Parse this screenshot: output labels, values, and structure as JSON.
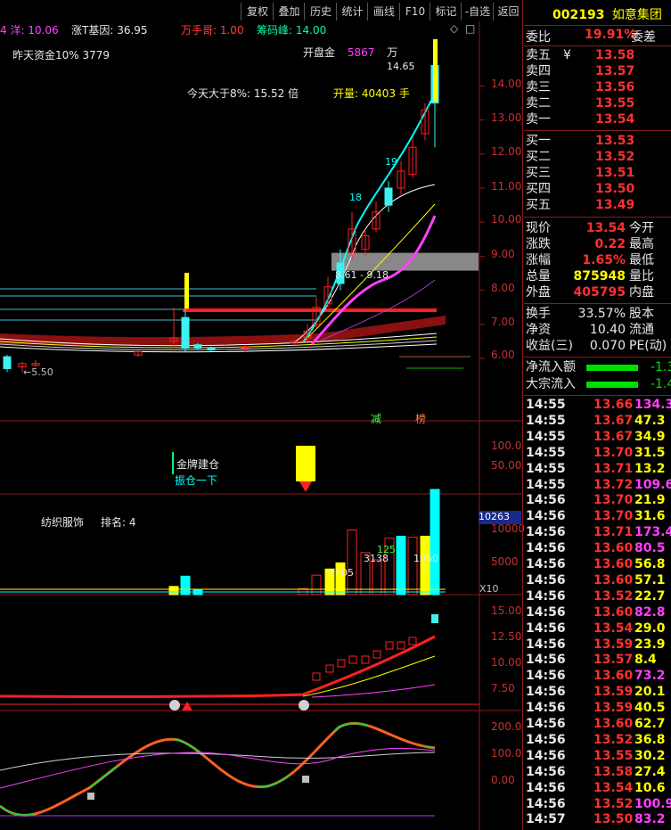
{
  "toolbar": {
    "buttons": [
      "复权",
      "叠加",
      "历史",
      "统计",
      "画线",
      "F10",
      "标记",
      "-自选",
      "返回"
    ]
  },
  "chart_header": {
    "ma_label": "4 洋: 10.06",
    "gene_label": "涨T基因: 36.95",
    "wanshouge": "万手哥: 1.00",
    "chouma": "筹码峰: 14.00"
  },
  "annotations": {
    "yesterday_fund": "昨天资金10%   3779",
    "open_amount_label": "开盘金",
    "open_amount_value": "5867",
    "open_amount_unit": "万",
    "today_ratio": "今天大于8%: 15.52 倍",
    "open_volume": "开量: 40403 手",
    "price_range": "8.61 - 9.18",
    "high_label": "14.65",
    "low_label": "5.50",
    "tag_jian": "减",
    "tag_bang": "榜",
    "jinpai": "金牌建仓",
    "zhencang": "振仓一下",
    "sector": "纺织服饰",
    "rank": "排名: 4",
    "vol_current": "10263",
    "vol_x10": "X10",
    "num_2505": "2505",
    "num_3138": "3138",
    "num_1050": "1050",
    "num_125": "125",
    "num_18": "18",
    "num_19": "19"
  },
  "price_axis": [
    "14.00",
    "13.00",
    "12.00",
    "11.00",
    "10.00",
    "9.00",
    "8.00",
    "7.00",
    "6.00"
  ],
  "sub1_axis": [
    "100.0",
    "50.00"
  ],
  "sub2_axis": [
    "10000",
    "5000"
  ],
  "sub3_axis": [
    "15.00",
    "12.50",
    "10.00",
    "7.50"
  ],
  "sub4_axis": [
    "200.0",
    "100.0",
    "0.00"
  ],
  "stock": {
    "code": "002193",
    "name": "如意集团"
  },
  "summary": {
    "weibi_label": "委比",
    "weibi_value": "19.91%",
    "weicha_label": "委差"
  },
  "asks": [
    {
      "label": "卖五",
      "flag": "¥",
      "price": "13.58"
    },
    {
      "label": "卖四",
      "flag": "",
      "price": "13.57"
    },
    {
      "label": "卖三",
      "flag": "",
      "price": "13.56"
    },
    {
      "label": "卖二",
      "flag": "",
      "price": "13.55"
    },
    {
      "label": "卖一",
      "flag": "",
      "price": "13.54"
    }
  ],
  "bids": [
    {
      "label": "买一",
      "price": "13.53"
    },
    {
      "label": "买二",
      "price": "13.52"
    },
    {
      "label": "买三",
      "price": "13.51"
    },
    {
      "label": "买四",
      "price": "13.50"
    },
    {
      "label": "买五",
      "price": "13.49"
    }
  ],
  "quote": [
    {
      "l": "现价",
      "v": "13.54",
      "r": "今开",
      "c": "red"
    },
    {
      "l": "涨跌",
      "v": "0.22",
      "r": "最高",
      "c": "red"
    },
    {
      "l": "涨幅",
      "v": "1.65%",
      "r": "最低",
      "c": "red"
    },
    {
      "l": "总量",
      "v": "875948",
      "r": "量比",
      "c": "yellow"
    },
    {
      "l": "外盘",
      "v": "405795",
      "r": "内盘",
      "c": "red"
    }
  ],
  "quote2": [
    {
      "l": "换手",
      "v": "33.57%",
      "r": "股本"
    },
    {
      "l": "净资",
      "v": "10.40",
      "r": "流通"
    },
    {
      "l": "收益(三)",
      "v": "0.070",
      "r": "PE(动)"
    }
  ],
  "flows": [
    {
      "l": "净流入额",
      "v": "-1.3"
    },
    {
      "l": "大宗流入",
      "v": "-1.4"
    }
  ],
  "ticks": [
    {
      "t": "14:55",
      "p": "13.66",
      "v": "134.3",
      "pc": "red",
      "vc": "mag"
    },
    {
      "t": "14:55",
      "p": "13.67",
      "v": "47.3",
      "pc": "red",
      "vc": "yellow"
    },
    {
      "t": "14:55",
      "p": "13.67",
      "v": "34.9",
      "pc": "red",
      "vc": "yellow"
    },
    {
      "t": "14:55",
      "p": "13.70",
      "v": "31.5",
      "pc": "red",
      "vc": "yellow"
    },
    {
      "t": "14:55",
      "p": "13.71",
      "v": "13.2",
      "pc": "red",
      "vc": "yellow"
    },
    {
      "t": "14:55",
      "p": "13.72",
      "v": "109.6",
      "pc": "red",
      "vc": "mag"
    },
    {
      "t": "14:56",
      "p": "13.70",
      "v": "21.9",
      "pc": "red",
      "vc": "yellow"
    },
    {
      "t": "14:56",
      "p": "13.70",
      "v": "31.6",
      "pc": "red",
      "vc": "yellow"
    },
    {
      "t": "14:56",
      "p": "13.71",
      "v": "173.4",
      "pc": "red",
      "vc": "mag"
    },
    {
      "t": "14:56",
      "p": "13.60",
      "v": "80.5",
      "pc": "red",
      "vc": "mag"
    },
    {
      "t": "14:56",
      "p": "13.60",
      "v": "56.8",
      "pc": "red",
      "vc": "yellow"
    },
    {
      "t": "14:56",
      "p": "13.60",
      "v": "57.1",
      "pc": "red",
      "vc": "yellow"
    },
    {
      "t": "14:56",
      "p": "13.52",
      "v": "22.7",
      "pc": "red",
      "vc": "yellow"
    },
    {
      "t": "14:56",
      "p": "13.60",
      "v": "82.8",
      "pc": "red",
      "vc": "mag"
    },
    {
      "t": "14:56",
      "p": "13.54",
      "v": "29.0",
      "pc": "red",
      "vc": "yellow"
    },
    {
      "t": "14:56",
      "p": "13.59",
      "v": "23.9",
      "pc": "red",
      "vc": "yellow"
    },
    {
      "t": "14:56",
      "p": "13.57",
      "v": "8.4",
      "pc": "red",
      "vc": "yellow"
    },
    {
      "t": "14:56",
      "p": "13.60",
      "v": "73.2",
      "pc": "red",
      "vc": "mag"
    },
    {
      "t": "14:56",
      "p": "13.59",
      "v": "20.1",
      "pc": "red",
      "vc": "yellow"
    },
    {
      "t": "14:56",
      "p": "13.59",
      "v": "40.5",
      "pc": "red",
      "vc": "yellow"
    },
    {
      "t": "14:56",
      "p": "13.60",
      "v": "62.7",
      "pc": "red",
      "vc": "yellow"
    },
    {
      "t": "14:56",
      "p": "13.52",
      "v": "36.8",
      "pc": "red",
      "vc": "yellow"
    },
    {
      "t": "14:56",
      "p": "13.55",
      "v": "30.2",
      "pc": "red",
      "vc": "yellow"
    },
    {
      "t": "14:56",
      "p": "13.58",
      "v": "27.4",
      "pc": "red",
      "vc": "yellow"
    },
    {
      "t": "14:56",
      "p": "13.54",
      "v": "10.6",
      "pc": "red",
      "vc": "yellow"
    },
    {
      "t": "14:56",
      "p": "13.52",
      "v": "100.9",
      "pc": "red",
      "vc": "mag"
    },
    {
      "t": "14:57",
      "p": "13.50",
      "v": "83.2",
      "pc": "red",
      "vc": "mag"
    }
  ],
  "colors": {
    "up": "#ff3030",
    "down": "#00ffff",
    "ma5": "#ffffff",
    "ma10": "#ffff00",
    "ma20": "#ff40ff",
    "grid": "#8b1a1a"
  }
}
